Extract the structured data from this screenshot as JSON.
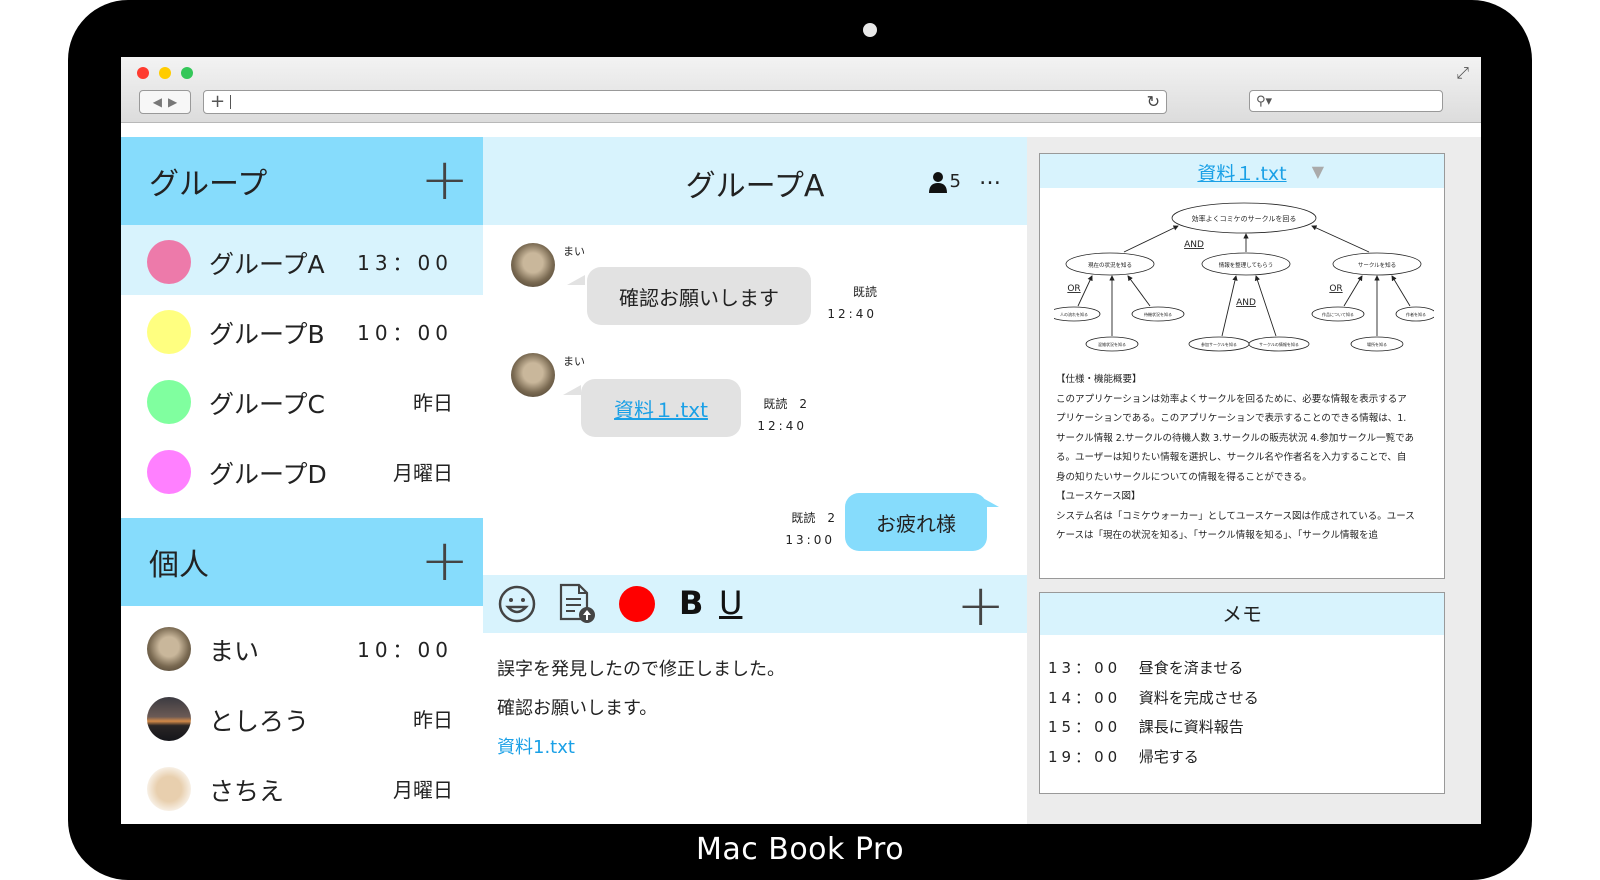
{
  "device": {
    "brand": "Mac Book Pro"
  },
  "browser": {
    "url_value": ""
  },
  "left": {
    "groups_title": "グループ",
    "groups": [
      {
        "name": "グループA",
        "time": "13：00",
        "color": "#ed7aaa"
      },
      {
        "name": "グループB",
        "time": "10：00",
        "color": "#ffff80"
      },
      {
        "name": "グループC",
        "time": "昨日",
        "color": "#80ff9f"
      },
      {
        "name": "グループD",
        "time": "月曜日",
        "color": "#ff80ff"
      }
    ],
    "personal_title": "個人",
    "personal": [
      {
        "name": "まい",
        "time": "10：00"
      },
      {
        "name": "としろう",
        "time": "昨日"
      },
      {
        "name": "さちえ",
        "time": "月曜日"
      }
    ]
  },
  "chat": {
    "title": "グループA",
    "member_count": "5",
    "more": "…",
    "messages": [
      {
        "sender": "まい",
        "text": "確認お願いします",
        "read": "既読",
        "time": "12:40"
      },
      {
        "sender": "まい",
        "text": "資料１.txt",
        "read": "既読　2",
        "time": "12:40"
      },
      {
        "text": "お疲れ様",
        "read": "既読　2",
        "time": "13:00"
      }
    ],
    "compose": {
      "line1": "誤字を発見したので修正しました。",
      "line2": "確認お願いします。",
      "link": "資料1.txt"
    }
  },
  "document": {
    "link": "資料１.txt",
    "diagram": {
      "root": "効率よくコミケのサークルを回る",
      "and_top": "AND",
      "child1": "現在の状況を知る",
      "child2": "情報を整理してもらう",
      "child3": "サークルを知る",
      "or1": "OR",
      "and2": "AND",
      "or3": "OR",
      "leaf1a": "人の流れを知る",
      "leaf1b": "待機状況を知る",
      "leaf1c": "混雑状況を知る",
      "leaf2a": "参加サークルを知る",
      "leaf2b": "サークルの情報を知る",
      "leaf3a": "作品について知る",
      "leaf3b": "作者を知る",
      "leaf3c": "場所を知る"
    },
    "text_lines": [
      "【仕様・機能概要】",
      "このアプリケーションは効率よくサークルを回るために、必要な情報を表示するア",
      "プリケーションである。このアプリケーションで表示することのできる情報は、1.",
      "サークル情報 2.サークルの待機人数 3.サークルの販売状況 4.参加サークル一覧であ",
      "る。ユーザーは知りたい情報を選択し、サークル名や作者名を入力することで、自",
      "身の知りたいサークルについての情報を得ることができる。",
      "【ユースケース図】",
      "システム名は「コミケウォーカー」としてユースケース図は作成されている。ユース",
      "ケースは「現在の状況を知る」、「サークル情報を知る」、「サークル情報を追"
    ]
  },
  "memo": {
    "title": "メモ",
    "items": [
      {
        "time": "13：00",
        "text": "昼食を済ませる"
      },
      {
        "time": "14：00",
        "text": "資料を完成させる"
      },
      {
        "time": "15：00",
        "text": "課長に資料報告"
      },
      {
        "time": "19：00",
        "text": "帰宅する"
      }
    ]
  }
}
